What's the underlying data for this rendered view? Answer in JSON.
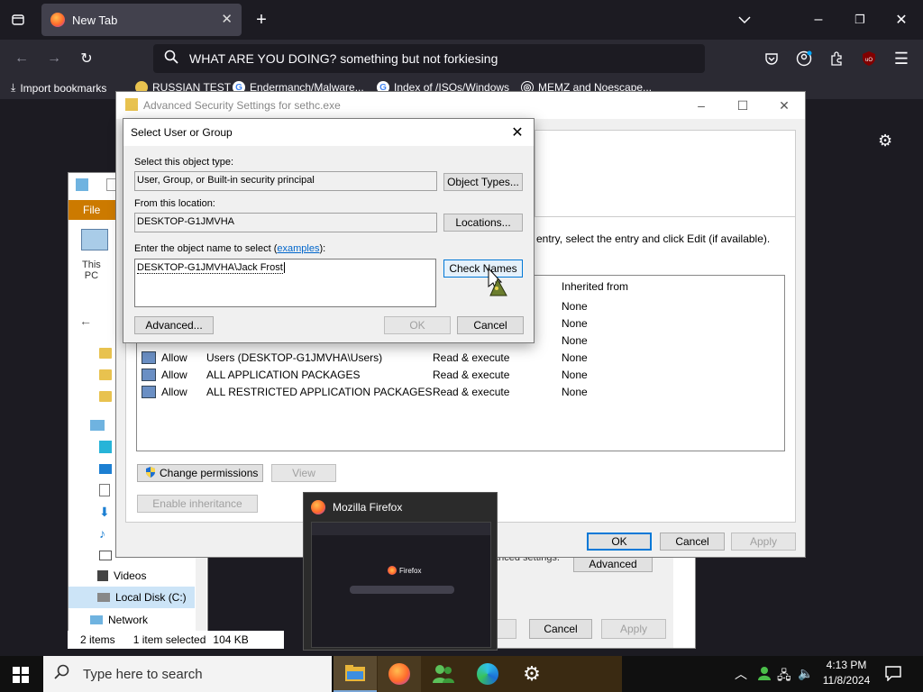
{
  "browser": {
    "tab_title": "New Tab",
    "url_text": "WHAT ARE YOU DOING? something but not forkiesing",
    "bookmarks": [
      "Import bookmarks",
      "RUSSIAN TEST",
      "Endermanch/Malware...",
      "Index of /ISOs/Windows",
      "MEMZ and Noescape..."
    ]
  },
  "explorer": {
    "ribbon_file": "File",
    "this_pc": [
      "This",
      "PC"
    ],
    "nav": [
      "Videos",
      "Local Disk (C:)",
      "Network"
    ],
    "status_items": "2 items",
    "status_selected": "1 item selected",
    "status_size": "104 KB"
  },
  "advanced": {
    "title": "Advanced Security Settings for sethc.exe",
    "hint": "entry, select the entry and click Edit (if available).",
    "inherited_header": "Inherited from",
    "rows": [
      {
        "type": "",
        "principal": "",
        "access": "",
        "inherited": "None"
      },
      {
        "type": "",
        "principal": "",
        "access": "",
        "inherited": "None"
      },
      {
        "type": "",
        "principal": "",
        "access": "",
        "inherited": "None"
      },
      {
        "type": "Allow",
        "principal": "Users (DESKTOP-G1JMVHA\\Users)",
        "access": "Read & execute",
        "inherited": "None"
      },
      {
        "type": "Allow",
        "principal": "ALL APPLICATION PACKAGES",
        "access": "Read & execute",
        "inherited": "None"
      },
      {
        "type": "Allow",
        "principal": "ALL RESTRICTED APPLICATION PACKAGES",
        "access": "Read & execute",
        "inherited": "None"
      }
    ],
    "change_permissions": "Change permissions",
    "view": "View",
    "enable_inheritance": "Enable inheritance",
    "ok": "OK",
    "cancel": "Cancel",
    "apply": "Apply"
  },
  "props_behind": {
    "fragment": "anced settings.",
    "advanced": "Advanced",
    "cancel": "Cancel",
    "apply": "Apply"
  },
  "select_dialog": {
    "title": "Select User or Group",
    "object_type_label": "Select this object type:",
    "object_type_value": "User, Group, or Built-in security principal",
    "object_types_button": "Object Types...",
    "location_label": "From this location:",
    "location_value": "DESKTOP-G1JMVHA",
    "locations_button": "Locations...",
    "name_label_pre": "Enter the object name to select (",
    "name_label_link": "examples",
    "name_label_post": "):",
    "name_value": "DESKTOP-G1JMVHA\\Jack Frost",
    "check_names": "Check Names",
    "advanced": "Advanced...",
    "ok": "OK",
    "cancel": "Cancel"
  },
  "thumbnail": {
    "title": "Mozilla Firefox",
    "inner_label": "Firefox"
  },
  "taskbar": {
    "search_placeholder": "Type here to search",
    "time": "4:13 PM",
    "date": "11/8/2024"
  }
}
